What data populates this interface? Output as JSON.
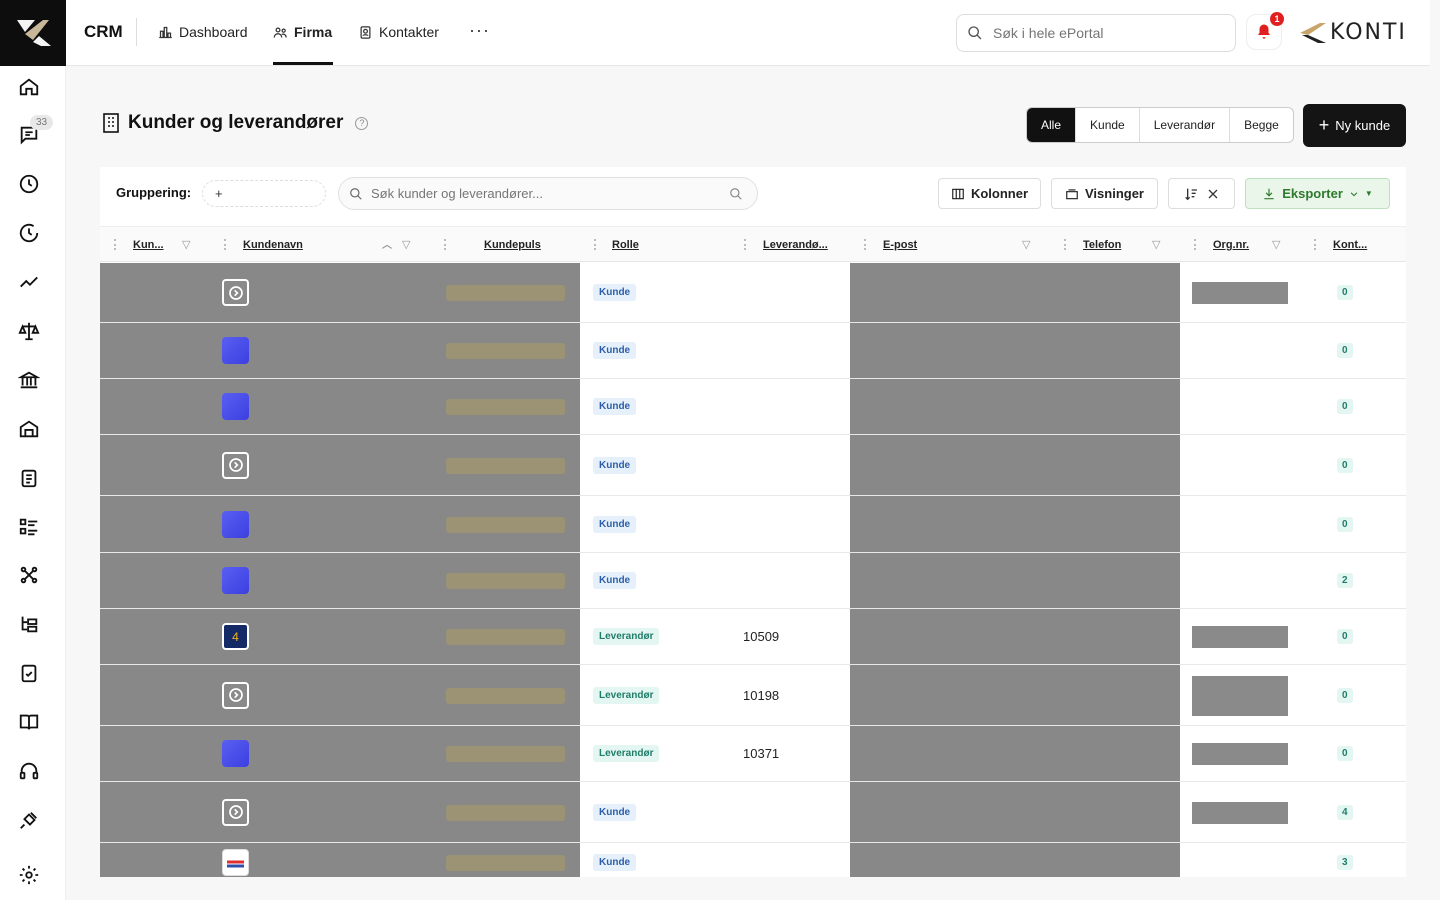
{
  "app": {
    "title": "CRM",
    "brand": "KONTI"
  },
  "sidebar": {
    "badge": "33"
  },
  "nav": {
    "items": [
      {
        "label": "Dashboard",
        "icon": "chart-icon"
      },
      {
        "label": "Firma",
        "icon": "people-icon",
        "active": true
      },
      {
        "label": "Kontakter",
        "icon": "contacts-icon"
      }
    ],
    "more": "···"
  },
  "global_search": {
    "placeholder": "Søk i hele ePortal"
  },
  "notifications": {
    "count": "1"
  },
  "page": {
    "title": "Kunder og leverandører",
    "help": "?",
    "filter_tabs": [
      "Alle",
      "Kunde",
      "Leverandør",
      "Begge"
    ],
    "active_filter": "Alle",
    "new_button": "Ny kunde"
  },
  "toolbar": {
    "grouping_label": "Gruppering:",
    "grouping_add": "+",
    "search_placeholder": "Søk kunder og leverandører...",
    "columns_label": "Kolonner",
    "views_label": "Visninger",
    "export_label": "Eksporter"
  },
  "table": {
    "headers": {
      "kun": "Kun...",
      "kundenavn": "Kundenavn",
      "kundepuls": "Kundepuls",
      "rolle": "Rolle",
      "leverandor": "Leverandø...",
      "epost": "E-post",
      "telefon": "Telefon",
      "orgnr": "Org.nr.",
      "kont": "Kont..."
    },
    "rows": [
      {
        "avatar": "arrow",
        "role": "Kunde",
        "lev_nr": "",
        "org": true,
        "kont": "0"
      },
      {
        "avatar": "blue",
        "role": "Kunde",
        "lev_nr": "",
        "org": false,
        "kont": "0"
      },
      {
        "avatar": "blue",
        "role": "Kunde",
        "lev_nr": "",
        "org": false,
        "kont": "0"
      },
      {
        "avatar": "arrow",
        "role": "Kunde",
        "lev_nr": "",
        "org": false,
        "kont": "0"
      },
      {
        "avatar": "blue",
        "role": "Kunde",
        "lev_nr": "",
        "org": false,
        "kont": "0"
      },
      {
        "avatar": "blue",
        "role": "Kunde",
        "lev_nr": "",
        "org": false,
        "kont": "2"
      },
      {
        "avatar": "num",
        "avatar_text": "4",
        "role": "Leverandør",
        "lev_nr": "10509",
        "org": true,
        "kont": "0"
      },
      {
        "avatar": "arrow",
        "role": "Leverandør",
        "lev_nr": "10198",
        "org": true,
        "kont": "0"
      },
      {
        "avatar": "blue",
        "role": "Leverandør",
        "lev_nr": "10371",
        "org": true,
        "kont": "0"
      },
      {
        "avatar": "arrow",
        "role": "Kunde",
        "lev_nr": "",
        "org": true,
        "kont": "4"
      },
      {
        "avatar": "flag",
        "role": "Kunde",
        "lev_nr": "",
        "org": false,
        "kont": "3"
      }
    ]
  }
}
